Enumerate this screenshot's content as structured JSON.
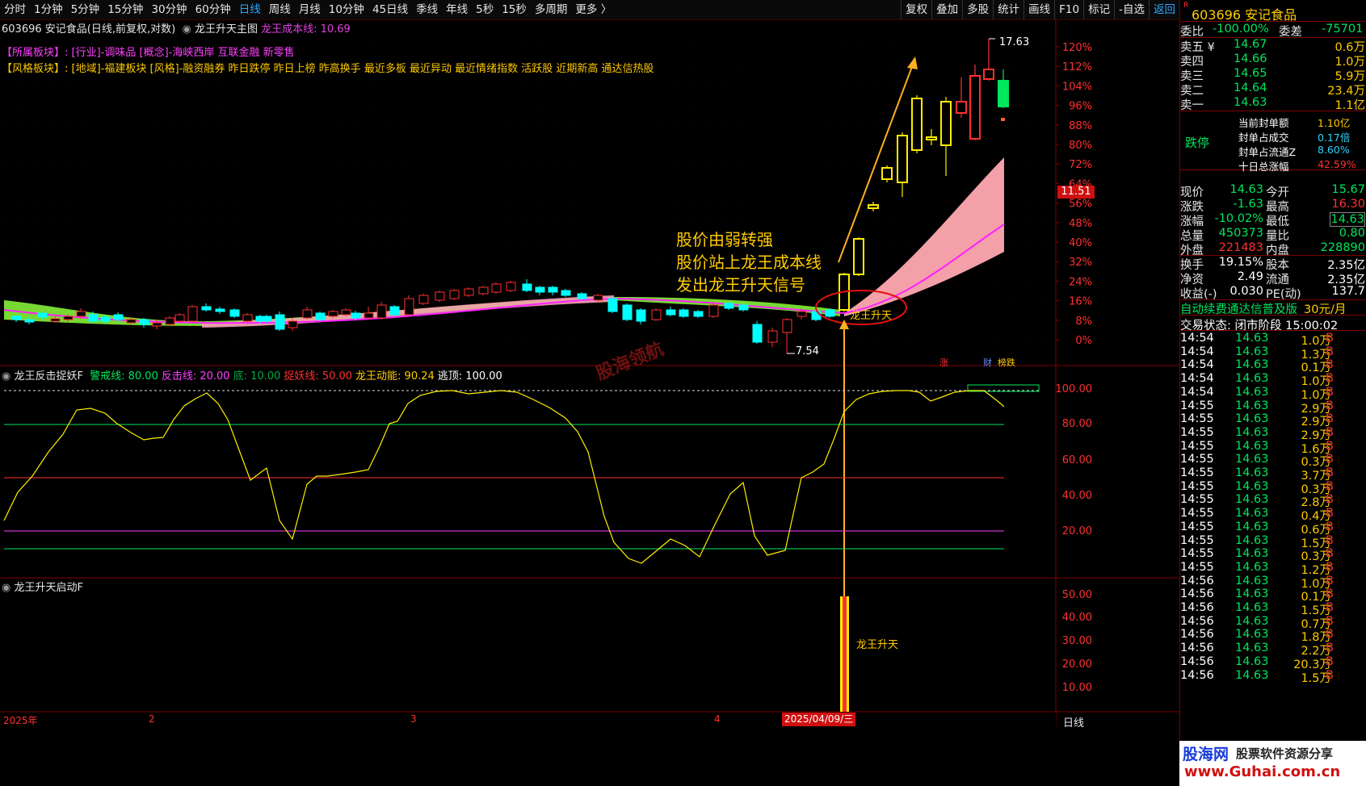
{
  "toolbar": {
    "periods": [
      "分时",
      "1分钟",
      "5分钟",
      "15分钟",
      "30分钟",
      "60分钟",
      "日线",
      "周线",
      "月线",
      "10分钟",
      "45日线",
      "季线",
      "年线",
      "5秒",
      "15秒",
      "多周期",
      "更多 〉"
    ],
    "active_period": "日线",
    "tools": [
      "复权",
      "叠加",
      "多股",
      "统计",
      "画线",
      "F10",
      "标记",
      "-自选",
      "返回"
    ]
  },
  "chart_header": {
    "stock": "603696 安记食品(日线,前复权,对数)",
    "main_indicator": "龙王升天主图",
    "cost_line": "龙王成本线: 10.69"
  },
  "sector_row": {
    "label": "【所属板块】:",
    "text_magenta": "[行业]-调味品 [概念]-海峡西岸 互联金融 新零售"
  },
  "style_row": {
    "label": "【风格板块】:",
    "text": "[地域]-福建板块 [风格]-融资融券 昨日跌停 昨日上榜 昨高换手 最近多板 最近异动 最近情绪指数 活跃股 近期新高 通达信热股"
  },
  "main_chart": {
    "y_axis_labels": [
      "120%",
      "112%",
      "104%",
      "96%",
      "88%",
      "80%",
      "72%",
      "64%",
      "56%",
      "48%",
      "40%",
      "32%",
      "24%",
      "16%",
      "8%",
      "0%"
    ],
    "current_price_tag": "11.51",
    "high_label": "17.63",
    "low_label": "7.54",
    "signal_label": "龙王升天",
    "annotation_lines": [
      "股价由弱转强",
      "股价站上龙王成本线",
      "发出龙王升天信号"
    ],
    "badges": [
      "涨",
      "财",
      "榜跌"
    ],
    "watermark": "股海领航"
  },
  "indicator1": {
    "title": "龙王反击捉妖F",
    "params": [
      {
        "text": "警戒线: 80.00",
        "color": "#00e65c"
      },
      {
        "text": "反击线: 20.00",
        "color": "#ff40ff"
      },
      {
        "text": "底: 10.00",
        "color": "#00aa44"
      },
      {
        "text": "捉妖线: 50.00",
        "color": "#ff3030"
      },
      {
        "text": "龙王动能: 90.24",
        "color": "#ffcc00"
      },
      {
        "text": "逃顶: 100.00",
        "color": "#ffffff"
      }
    ],
    "y_axis_labels": [
      "100.00",
      "80.00",
      "60.00",
      "40.00",
      "20.00"
    ]
  },
  "indicator2": {
    "title": "龙王升天启动F",
    "bar_label": "龙王升天",
    "y_axis_labels": [
      "50.00",
      "40.00",
      "30.00",
      "20.00",
      "10.00"
    ]
  },
  "x_axis": {
    "labels": [
      "2025年",
      "2",
      "3",
      "4"
    ],
    "date_highlight": "2025/04/09/三",
    "period": "日线"
  },
  "quote_panel": {
    "code": "603696",
    "name": "安记食品",
    "wb_label": "委比",
    "wb_value": "-100.00%",
    "wc_label": "委差",
    "wc_value": "-75701",
    "asks": [
      {
        "label": "卖五 ¥",
        "price": "14.67",
        "vol": "0.6万"
      },
      {
        "label": "卖四",
        "price": "14.66",
        "vol": "1.0万"
      },
      {
        "label": "卖三",
        "price": "14.65",
        "vol": "5.9万"
      },
      {
        "label": "卖二",
        "price": "14.64",
        "vol": "23.4万"
      },
      {
        "label": "卖一",
        "price": "14.63",
        "vol": "1.1亿"
      }
    ],
    "limit_status": "跌停",
    "seal_info": [
      {
        "label": "当前封单额",
        "value": "1.10亿"
      },
      {
        "label": "封单占成交",
        "value": "0.17倍"
      },
      {
        "label": "封单占流通Z",
        "value": "8.60%"
      },
      {
        "label": "十日总涨幅",
        "value": "42.59%"
      }
    ],
    "stats": [
      {
        "l1": "现价",
        "v1": "14.63",
        "l2": "今开",
        "v2": "15.67"
      },
      {
        "l1": "涨跌",
        "v1": "-1.63",
        "l2": "最高",
        "v2": "16.30"
      },
      {
        "l1": "涨幅",
        "v1": "-10.02%",
        "l2": "最低",
        "v2": "14.63"
      },
      {
        "l1": "总量",
        "v1": "450373",
        "l2": "量比",
        "v2": "0.80"
      },
      {
        "l1": "外盘",
        "v1": "221483",
        "l2": "内盘",
        "v2": "228890"
      }
    ],
    "stats2": [
      {
        "l1": "换手",
        "v1": "19.15%",
        "l2": "股本",
        "v2": "2.35亿"
      },
      {
        "l1": "净资",
        "v1": "2.49",
        "l2": "流通",
        "v2": "2.35亿"
      },
      {
        "l1": "收益(-)",
        "v1": "0.030",
        "l2": "PE(动)",
        "v2": "137.7"
      }
    ],
    "promo": "自动续费通达信普及版",
    "promo_price": "30元/月",
    "trade_status": "交易状态: 闭市阶段 15:00:02",
    "ticks": [
      [
        "14:54",
        "14.63",
        "1.0万",
        "B"
      ],
      [
        "14:54",
        "14.63",
        "1.3万",
        "B"
      ],
      [
        "14:54",
        "14.63",
        "0.1万",
        "B"
      ],
      [
        "14:54",
        "14.63",
        "1.0万",
        "B"
      ],
      [
        "14:54",
        "14.63",
        "1.0万",
        "B"
      ],
      [
        "14:55",
        "14.63",
        "2.9万",
        "B"
      ],
      [
        "14:55",
        "14.63",
        "2.9万",
        "B"
      ],
      [
        "14:55",
        "14.63",
        "2.9万",
        "B"
      ],
      [
        "14:55",
        "14.63",
        "1.6万",
        "B"
      ],
      [
        "14:55",
        "14.63",
        "0.3万",
        "B"
      ],
      [
        "14:55",
        "14.63",
        "3.7万",
        "B"
      ],
      [
        "14:55",
        "14.63",
        "0.3万",
        "B"
      ],
      [
        "14:55",
        "14.63",
        "2.8万",
        "B"
      ],
      [
        "14:55",
        "14.63",
        "0.4万",
        "B"
      ],
      [
        "14:55",
        "14.63",
        "0.6万",
        "B"
      ],
      [
        "14:55",
        "14.63",
        "1.5万",
        "B"
      ],
      [
        "14:55",
        "14.63",
        "0.3万",
        "B"
      ],
      [
        "14:55",
        "14.63",
        "1.2万",
        "B"
      ],
      [
        "14:56",
        "14.63",
        "1.0万",
        "B"
      ],
      [
        "14:56",
        "14.63",
        "0.1万",
        "B"
      ],
      [
        "14:56",
        "14.63",
        "1.5万",
        "B"
      ],
      [
        "14:56",
        "14.63",
        "0.7万",
        "B"
      ],
      [
        "14:56",
        "14.63",
        "1.8万",
        "B"
      ],
      [
        "14:56",
        "14.63",
        "2.2万",
        "B"
      ],
      [
        "14:56",
        "14.63",
        "20.3万",
        "B"
      ],
      [
        "14:56",
        "14.63",
        "1.5万",
        "B"
      ]
    ],
    "logo_text": "股海网",
    "logo_sub": "股票软件资源分享",
    "logo_url": "www.Guhai.com.cn"
  }
}
